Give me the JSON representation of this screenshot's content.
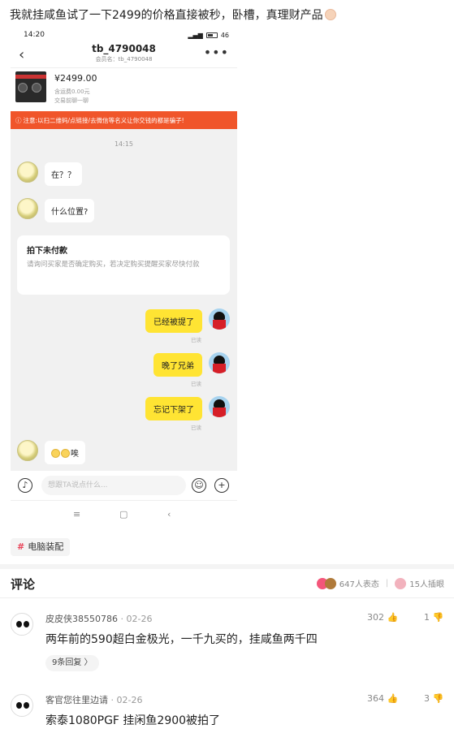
{
  "post": {
    "title": "我就挂咸鱼试了一下2499的价格直接被秒，卧槽，真理财产品"
  },
  "phone": {
    "status": {
      "time": "14:20",
      "battery": "46"
    },
    "chat": {
      "peer_name": "tb_4790048",
      "peer_sub": "会员名：tb_4790048",
      "product": {
        "price": "¥2499.00",
        "shipping": "含运费0.00元",
        "trade_type": "交易前聊一聊"
      },
      "warning": "注意:以扫二维码/点链接/去微信等名义让你交钱的都是骗子!",
      "time_separator": "14:15",
      "messages": [
        {
          "side": "left",
          "text": "在？？"
        },
        {
          "side": "left",
          "text": "什么位置?"
        },
        {
          "side": "right",
          "text": "已经被提了",
          "read": "已读"
        },
        {
          "side": "right",
          "text": "晚了兄弟",
          "read": "已读"
        },
        {
          "side": "right",
          "text": "忘记下架了",
          "read": "已读"
        },
        {
          "side": "left",
          "text": "唉"
        }
      ],
      "card": {
        "title": "拍下未付款",
        "body": "请询问买家是否确定购买，若决定购买提醒买家尽快付款"
      },
      "input_placeholder": "想跟TA说点什么..."
    },
    "nav": {
      "menu": "≡",
      "home": "▢",
      "back": "‹"
    }
  },
  "tag": {
    "label": "电脑装配"
  },
  "comments_section": {
    "title": "评论",
    "reactions_count": "647人表态",
    "insert_count": "15人插眼"
  },
  "comments": [
    {
      "user": "皮皮侠38550786",
      "date": "· 02-26",
      "likes": "302",
      "dislikes": "1",
      "text": "两年前的590超白金极光，一千九买的，挂咸鱼两千四",
      "replies": "9条回复 〉"
    },
    {
      "user": "客官您往里边请",
      "date": "· 02-26",
      "likes": "364",
      "dislikes": "3",
      "text": "索泰1080PGF 挂闲鱼2900被拍了"
    }
  ],
  "colors": {
    "accent_yellow": "#ffe433",
    "warning_orange": "#f0552a",
    "tag_hash": "#e9455a"
  },
  "icons": [
    "back-arrow-icon",
    "more-icon",
    "voice-icon",
    "emoji-icon",
    "add-icon",
    "thumb-up-icon",
    "thumb-down-icon",
    "hashtag-icon"
  ]
}
